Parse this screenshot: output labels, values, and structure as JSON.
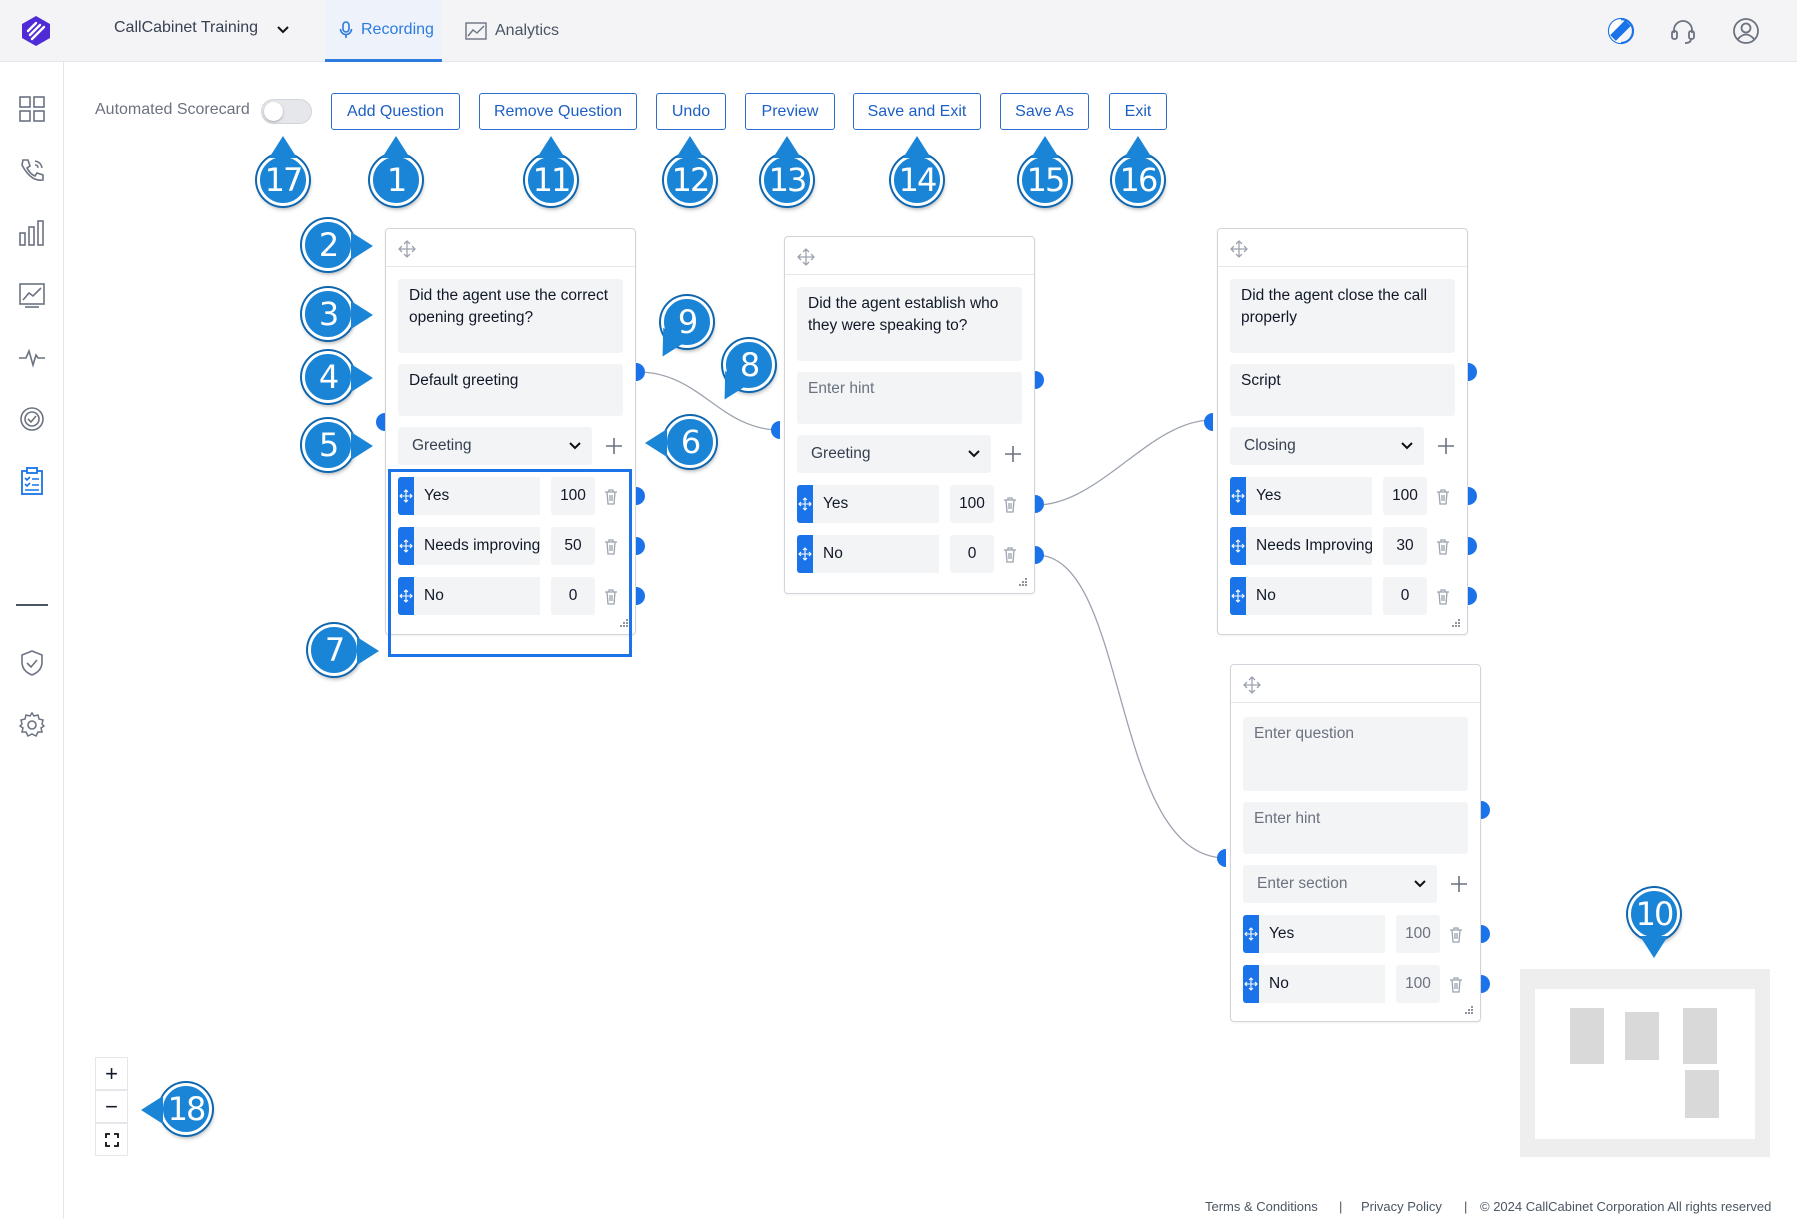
{
  "header": {
    "organization": "CallCabinet Training",
    "tabs": [
      {
        "label": "Recording",
        "active": true,
        "icon": "microphone-icon"
      },
      {
        "label": "Analytics",
        "active": false,
        "icon": "analytics-chart-icon"
      }
    ],
    "right_icons": [
      "theme-toggle-icon",
      "headset-support-icon",
      "user-profile-icon"
    ]
  },
  "sidebar": {
    "items": [
      "dashboard-grid-icon",
      "phone-calls-icon",
      "bar-chart-icon",
      "trend-chart-icon",
      "pulse-waveform-icon",
      "check-circle-icon",
      "scorecard-clipboard-icon",
      "shield-check-icon",
      "settings-gear-icon"
    ]
  },
  "toolbar": {
    "automated_label": "Automated Scorecard",
    "automated_on": false,
    "buttons": [
      "Add Question",
      "Remove Question",
      "Undo",
      "Preview",
      "Save and Exit",
      "Save As",
      "Exit"
    ]
  },
  "cards": [
    {
      "question": "Did the agent use the correct opening greeting?",
      "hint": "Default greeting",
      "section": "Greeting",
      "answers": [
        {
          "label": "Yes",
          "score": "100"
        },
        {
          "label": "Needs improving",
          "score": "50"
        },
        {
          "label": "No",
          "score": "0"
        }
      ]
    },
    {
      "question": "Did the agent establish who they were speaking to?",
      "hint": "Enter hint",
      "section": "Greeting",
      "answers": [
        {
          "label": "Yes",
          "score": "100"
        },
        {
          "label": "No",
          "score": "0"
        }
      ]
    },
    {
      "question": "Did the agent close the call properly",
      "hint": "Script",
      "section": "Closing",
      "answers": [
        {
          "label": "Yes",
          "score": "100"
        },
        {
          "label": "Needs Improving",
          "score": "30"
        },
        {
          "label": "No",
          "score": "0"
        }
      ]
    },
    {
      "question": "Enter question",
      "hint": "Enter hint",
      "section": "Enter section",
      "answers": [
        {
          "label": "Yes",
          "score": "100"
        },
        {
          "label": "No",
          "score": "100"
        }
      ]
    }
  ],
  "callouts": [
    "1",
    "2",
    "3",
    "4",
    "5",
    "6",
    "7",
    "8",
    "9",
    "10",
    "11",
    "12",
    "13",
    "14",
    "15",
    "16",
    "17",
    "18"
  ],
  "zoom_controls": {
    "zoom_in": "+",
    "zoom_out": "−"
  },
  "footer": {
    "terms": "Terms & Conditions",
    "sep": "|",
    "privacy": "Privacy Policy",
    "copyright": "© 2024 CallCabinet Corporation All rights reserved"
  },
  "colors": {
    "accent": "#1a73e8",
    "callout": "#1a84d6",
    "button_text": "#1d5fc4"
  }
}
